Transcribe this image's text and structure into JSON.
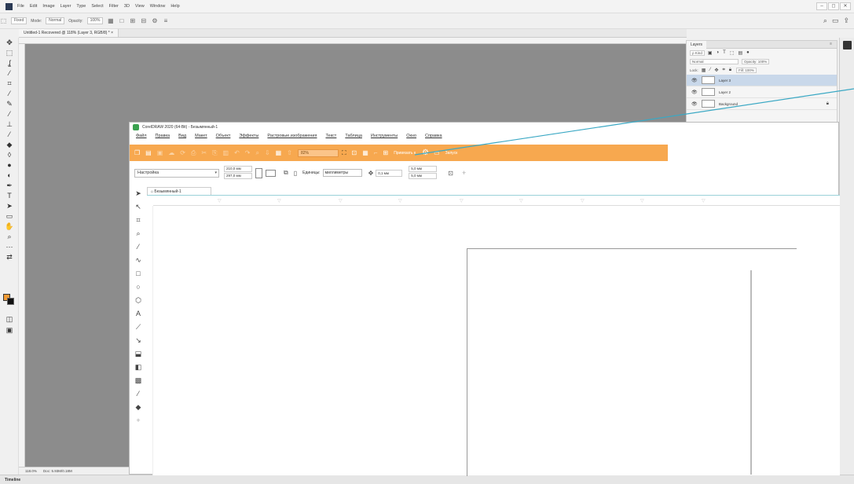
{
  "photoshop": {
    "menu": [
      "File",
      "Edit",
      "Image",
      "Layer",
      "Type",
      "Select",
      "Filter",
      "3D",
      "View",
      "Window",
      "Help"
    ],
    "window_buttons": [
      "–",
      "◻",
      "✕"
    ],
    "options": {
      "mode_label": "Mode:",
      "mode_value": "Normal",
      "opacity_label": "Opacity:",
      "opacity_value": "100%",
      "style_value": "Fixed"
    },
    "doc_tab": "Untitled-1 Recovered @ 118% (Layer 3, RGB/8) * ×",
    "status": {
      "zoom": "118.0%",
      "doc": "Doc: 5.93M/0.18M"
    },
    "timeline_label": "Timeline",
    "layers_panel": {
      "title": "Layers",
      "kind_label": "ρ Kind",
      "blend_mode": "Normal",
      "opacity_label": "Opacity: 100%",
      "lock_label": "Lock:",
      "fill_label": "Fill: 100%",
      "layers": [
        {
          "name": "Layer 3",
          "selected": true
        },
        {
          "name": "Layer 2",
          "selected": false
        },
        {
          "name": "Background",
          "selected": false,
          "locked": true
        }
      ]
    }
  },
  "coreldraw": {
    "title": "CorelDRAW 2020 (64-Bit) - Безымянный-1",
    "menu": [
      "Файл",
      "Правка",
      "Вид",
      "Макет",
      "Объект",
      "Эффекты",
      "Растровые изображения",
      "Текст",
      "Таблица",
      "Инструменты",
      "Окно",
      "Справка"
    ],
    "toolbar": {
      "zoom": "82%",
      "snap_label": "Привязать к",
      "launch_label": "Запуск"
    },
    "propbar": {
      "preset": "Настройка",
      "width": "210,0 мм",
      "height": "297,0 мм",
      "units_label": "Единицы:",
      "units_value": "миллиметры",
      "nudge": "0,1 мм",
      "dup_x": "5,0 мм",
      "dup_y": "5,0 мм"
    },
    "doc_tab": "Безымянный-1"
  },
  "colors": {
    "corel_toolbar": "#f7a84f",
    "ps_canvas": "#8c8c8c",
    "foreground": "#f39b35",
    "annotation": "#3aa8c4",
    "selected_layer": "#c9d8ea"
  }
}
